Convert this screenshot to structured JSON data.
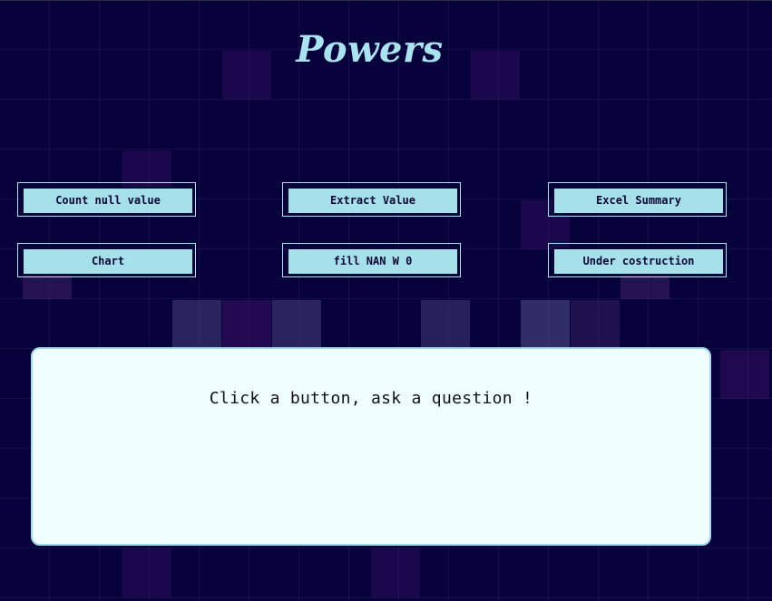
{
  "header": {
    "title": "Powers"
  },
  "buttons": {
    "count_null": "Count null value",
    "extract_value": "Extract Value",
    "excel_summary": "Excel Summary",
    "chart": "Chart",
    "fill_nan": "fill NAN W 0",
    "under_construction": "Under costruction"
  },
  "output": {
    "message": "Click a button, ask a question !"
  },
  "colors": {
    "background": "#06013a",
    "accent": "#a9e3ef",
    "button_fill": "#a6e0ea",
    "panel_fill": "#effffe"
  }
}
